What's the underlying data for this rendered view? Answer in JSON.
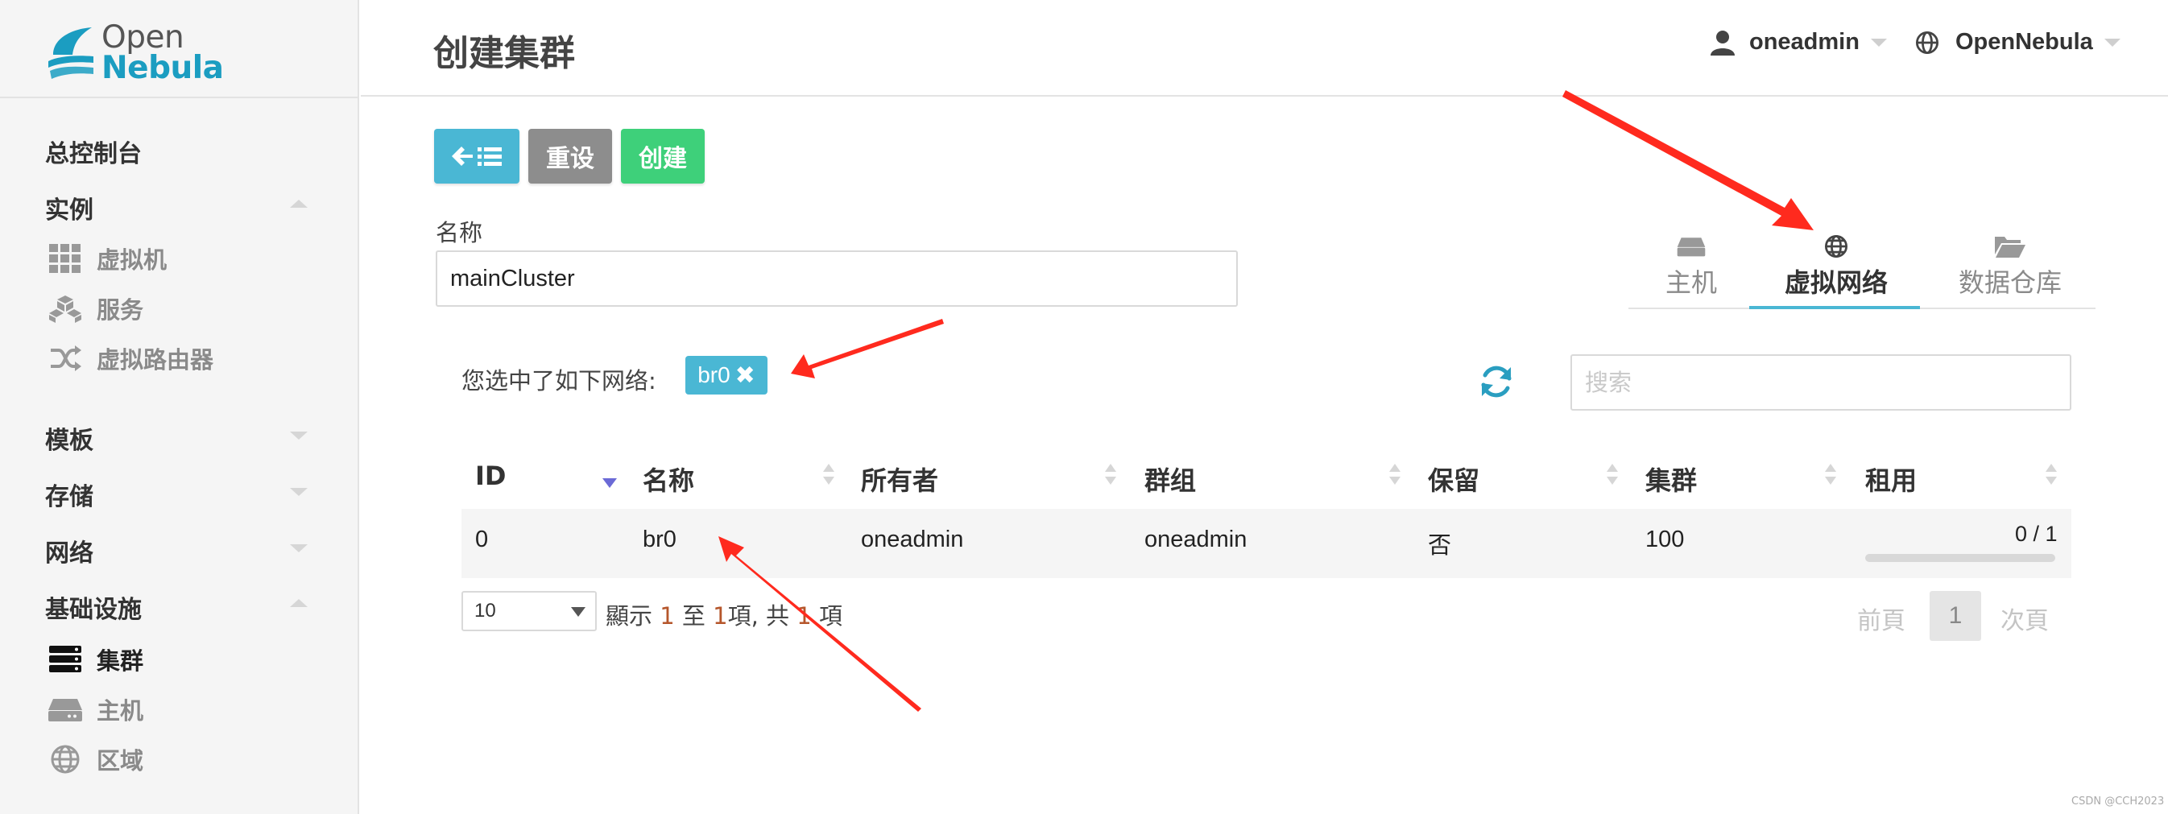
{
  "logo": {
    "line1": "Open",
    "line2": "Nebula"
  },
  "sidebar": {
    "dashboard": "总控制台",
    "instances": {
      "label": "实例",
      "items": [
        {
          "label": "虚拟机",
          "icon": "grid-icon"
        },
        {
          "label": "服务",
          "icon": "cubes-icon"
        },
        {
          "label": "虚拟路由器",
          "icon": "shuffle-icon"
        }
      ]
    },
    "templates": "模板",
    "storage": "存储",
    "network": "网络",
    "infrastructure": {
      "label": "基础设施",
      "items": [
        {
          "label": "集群",
          "icon": "server-icon",
          "active": true
        },
        {
          "label": "主机",
          "icon": "hdd-icon"
        },
        {
          "label": "区域",
          "icon": "globe-icon"
        }
      ]
    }
  },
  "header": {
    "title": "创建集群",
    "user": "oneadmin",
    "zone": "OpenNebula"
  },
  "toolbar": {
    "back_icon": "arrow-left-list-icon",
    "reset_label": "重设",
    "create_label": "创建"
  },
  "form": {
    "name_label": "名称",
    "name_value": "mainCluster"
  },
  "tabs": [
    {
      "label": "主机",
      "icon": "hdd-icon"
    },
    {
      "label": "虚拟网络",
      "icon": "globe-icon",
      "active": true
    },
    {
      "label": "数据仓库",
      "icon": "folder-open-icon"
    }
  ],
  "selection": {
    "label": "您选中了如下网络:",
    "chip_label": "br0",
    "chip_remove": "✖"
  },
  "search": {
    "placeholder": "搜索"
  },
  "table": {
    "headers": [
      "ID",
      "名称",
      "所有者",
      "群组",
      "保留",
      "集群",
      "租用"
    ],
    "rows": [
      {
        "id": "0",
        "name": "br0",
        "owner": "oneadmin",
        "group": "oneadmin",
        "reserved": "否",
        "cluster": "100",
        "leases": "0 / 1",
        "lease_fraction": 0
      }
    ]
  },
  "pagination": {
    "page_size": "10",
    "info_prefix": "顯示",
    "info_from": "1",
    "info_to_word": "至",
    "info_to": "1",
    "info_items": "項",
    "info_total_word": "共",
    "info_total": "1",
    "info_suffix": "項",
    "prev": "前頁",
    "current": "1",
    "next": "次頁"
  },
  "watermark": "CSDN @CCH2023",
  "colors": {
    "accent": "#4ab7d4",
    "create": "#3ed07a",
    "reset": "#8d8d8d",
    "arrow": "#ff2a1e"
  }
}
